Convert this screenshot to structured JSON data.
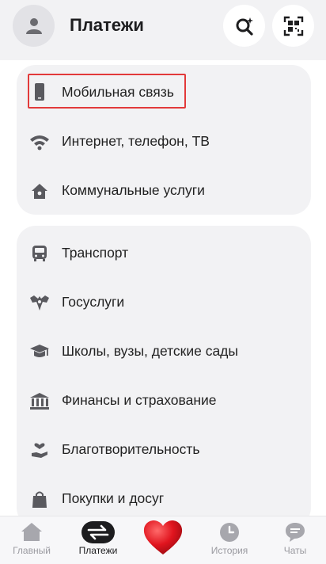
{
  "header": {
    "title": "Платежи",
    "avatar_icon": "user-icon",
    "search_icon": "search-sparkle-icon",
    "qr_icon": "qr-scan-icon"
  },
  "groups": [
    {
      "items": [
        {
          "label": "Мобильная связь",
          "icon": "phone-icon"
        },
        {
          "label": "Интернет, телефон, ТВ",
          "icon": "wifi-icon"
        },
        {
          "label": "Коммунальные услуги",
          "icon": "home-icon"
        }
      ]
    },
    {
      "items": [
        {
          "label": "Транспорт",
          "icon": "bus-icon"
        },
        {
          "label": "Госуслуги",
          "icon": "eagle-icon"
        },
        {
          "label": "Школы, вузы, детские сады",
          "icon": "graduation-cap-icon"
        },
        {
          "label": "Финансы и страхование",
          "icon": "bank-icon"
        },
        {
          "label": "Благотворительность",
          "icon": "charity-icon"
        },
        {
          "label": "Покупки и досуг",
          "icon": "shopping-bag-icon"
        }
      ]
    }
  ],
  "tabbar": {
    "tabs": [
      {
        "label": "Главный",
        "icon": "home-tab-icon",
        "active": false
      },
      {
        "label": "Платежи",
        "icon": "transfer-icon",
        "active": true
      },
      {
        "label": "",
        "icon": "heart-icon",
        "active": false
      },
      {
        "label": "История",
        "icon": "clock-icon",
        "active": false
      },
      {
        "label": "Чаты",
        "icon": "chat-icon",
        "active": false
      }
    ]
  },
  "colors": {
    "background": "#f2f2f4",
    "highlight": "#e23a3a",
    "heart": "#e0141e",
    "icon": "#5a5a5f"
  }
}
